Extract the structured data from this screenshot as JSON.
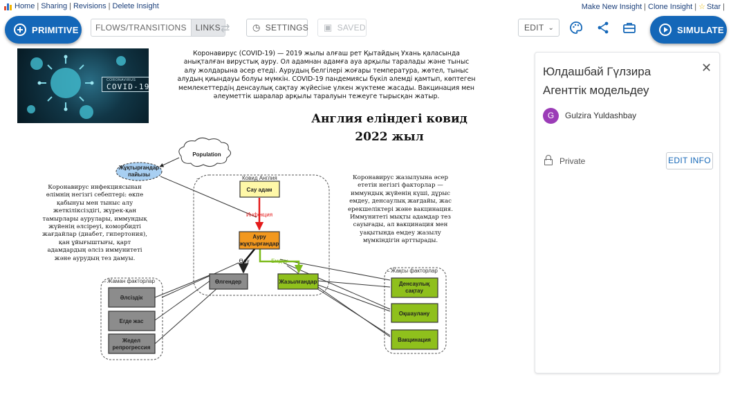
{
  "topbar": {
    "links_left": [
      "Home",
      "Sharing",
      "Revisions",
      "Delete Insight"
    ],
    "links_right": [
      "Make New Insight",
      "Clone Insight",
      "Star"
    ],
    "separator": "|",
    "logo_icon": "insightmaker-logo-icon"
  },
  "toolbar": {
    "primitive_label": "PRIMITIVE",
    "flows_label": "FLOWS/TRANSITIONS",
    "links_label": "LINKS",
    "settings_label": "SETTINGS",
    "saved_label": "SAVED",
    "edit_label": "EDIT",
    "simulate_label": "SIMULATE",
    "icons": [
      "plus-circle-icon",
      "swap-icon",
      "clock-icon",
      "save-icon",
      "chevron-down-icon",
      "palette-icon",
      "share-icon",
      "toolbox-icon",
      "play-icon"
    ],
    "accent_color": "#1467b8"
  },
  "canvas": {
    "image_banner_small": "CORONAVIRUS",
    "image_banner": "COVID-19",
    "intro_text": "Коронавирус (COVID-19) — 2019 жылы алғаш рет Қытайдың Ухань қаласында анықталған вирустық ауру. Ол адамнан адамға ауа арқылы таралады және тыныс алу жолдарына әсер етеді. Аурудың белгілері жоғары температура, жөтел, тыныс алудың қиындауы болуы мүмкін. COVID-19 пандемиясы бүкіл әлемді қамтып, көптеген мемлекеттердің денсаулық сақтау жүйесіне үлкен жүктеме жасады. Вакцинация мен әлеуметтік шаралар арқылы таралуын тежеуге тырысқан жатыр.",
    "title_line1": "Англия еліндегі ковид",
    "title_line2": "2022 жыл",
    "left_text": "Коронавирус инфекциясынан өлімнің негізгі себептері: өкпе қабынуы мен тыныс алу жеткіліксіздігі, жүрек-қан тамырлары аурулары, иммундық жүйенің әлсіреуі, коморбидті жағдайлар (диабет, гипертония), қан ұйығыштығы, қарт адамдардың әлсіз иммунитеті және аурудың тез дамуы.",
    "right_text": "Коронавирус жазылуына әсер ететін негізгі факторлар — иммундық жүйенің күші, дұрыс емдеу, денсаулық жағдайы, жас ерекшеліктері және вакцинация. Иммунитеті мықты адамдар тез сауығады, ал вакцинация мен уақытында емдеу жазылу мүмкіндігін арттырады.",
    "cloud_label": "Population",
    "variable_label_1": "Жұқтырғандар",
    "variable_label_2": "пайызы",
    "folder_main": "Ковид Англия",
    "folder_bad": "Жаман факторлар",
    "folder_good": "Жақсы факторлар",
    "stock_healthy": "Сау адам",
    "stock_infected_1": "Ауру",
    "stock_infected_2": "жұқтырғандар",
    "stock_dead": "Өлгендер",
    "stock_recovered": "Жазылғандар",
    "flow_infection": "Инфекция",
    "flow_death": "Өлу",
    "flow_treatment": "Емдеу",
    "bad_1": "Әлсіздік",
    "bad_2": "Егде жас",
    "bad_3_line1": "Жедел",
    "bad_3_line2": "репрогрессия",
    "good_1_line1": "Денсаулық",
    "good_1_line2": "сақтау",
    "good_2": "Оқшаулану",
    "good_3": "Вакцинация",
    "collapse_glyph": "−"
  },
  "panel": {
    "title": "Юлдашбай Гүлзира Агенттік модельдеу",
    "close_icon": "close-icon",
    "avatar_letter": "G",
    "author": "Gulzira Yuldashbay",
    "privacy_icon": "lock-icon",
    "privacy": "Private",
    "edit_info_label": "EDIT INFO",
    "avatar_color": "#9b3cb7"
  }
}
